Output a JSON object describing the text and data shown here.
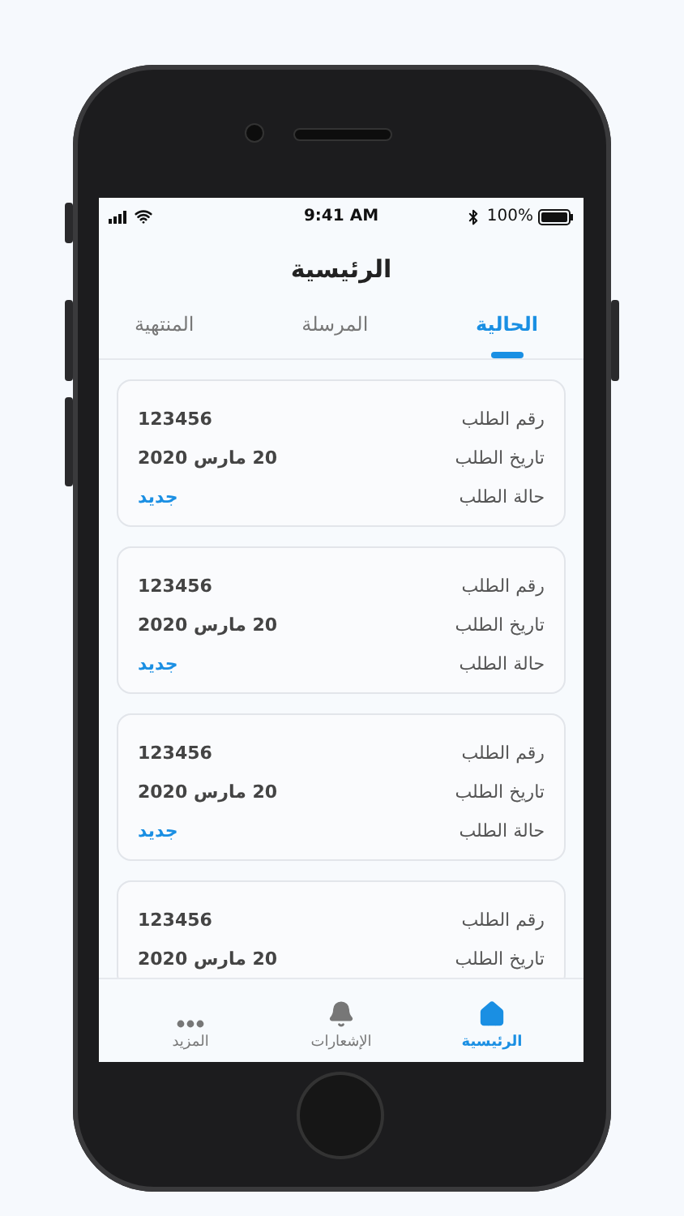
{
  "status_bar": {
    "time": "9:41 AM",
    "battery": "100%"
  },
  "title": "الرئيسية",
  "tabs": [
    {
      "label": "الحالية",
      "selected": true
    },
    {
      "label": "المرسلة",
      "selected": false
    },
    {
      "label": "المنتهية",
      "selected": false
    }
  ],
  "orders": [
    {
      "fields": [
        {
          "label": "رقم الطلب",
          "value": "123456",
          "kind": "text"
        },
        {
          "label": "تاريخ الطلب",
          "value": "20 مارس 2020",
          "kind": "text"
        },
        {
          "label": "حالة الطلب",
          "value": "جديد",
          "kind": "status"
        }
      ]
    },
    {
      "fields": [
        {
          "label": "رقم الطلب",
          "value": "123456",
          "kind": "text"
        },
        {
          "label": "تاريخ الطلب",
          "value": "20 مارس 2020",
          "kind": "text"
        },
        {
          "label": "حالة الطلب",
          "value": "جديد",
          "kind": "status"
        }
      ]
    },
    {
      "fields": [
        {
          "label": "رقم الطلب",
          "value": "123456",
          "kind": "text"
        },
        {
          "label": "تاريخ الطلب",
          "value": "20 مارس 2020",
          "kind": "text"
        },
        {
          "label": "حالة الطلب",
          "value": "جديد",
          "kind": "status"
        }
      ]
    },
    {
      "fields": [
        {
          "label": "رقم الطلب",
          "value": "123456",
          "kind": "text"
        },
        {
          "label": "تاريخ الطلب",
          "value": "20 مارس 2020",
          "kind": "text"
        }
      ]
    }
  ],
  "bottom_nav": [
    {
      "label": "الرئيسية",
      "kind": "home",
      "selected": true
    },
    {
      "label": "الإشعارات",
      "kind": "bell",
      "selected": false
    },
    {
      "label": "المزيد",
      "kind": "more",
      "selected": false
    }
  ]
}
